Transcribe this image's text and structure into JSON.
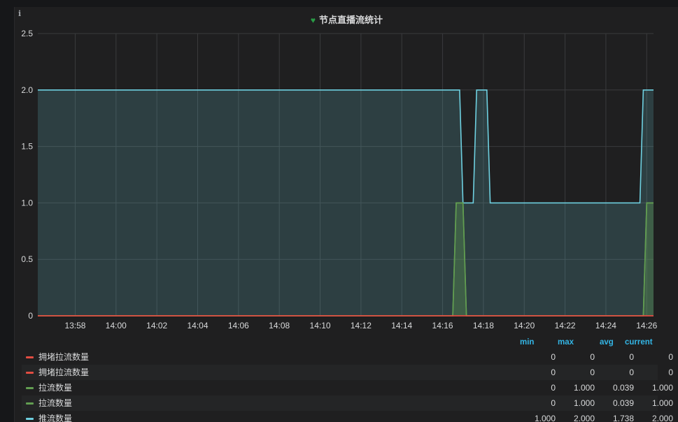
{
  "panel": {
    "title": "节点直播流统计",
    "info_glyph": "i",
    "title_icon": "heart-icon"
  },
  "chart_data": {
    "type": "line",
    "title": "节点直播流统计",
    "ylim": [
      0,
      2.5
    ],
    "yticks": [
      "0",
      "0.5",
      "1.0",
      "1.5",
      "2.0",
      "2.5"
    ],
    "ytick_values": [
      0,
      0.5,
      1.0,
      1.5,
      2.0,
      2.5
    ],
    "xlim": [
      "13:56:10",
      "14:26:20"
    ],
    "xticks": [
      "13:58",
      "14:00",
      "14:02",
      "14:04",
      "14:06",
      "14:08",
      "14:10",
      "14:12",
      "14:14",
      "14:16",
      "14:18",
      "14:20",
      "14:22",
      "14:24",
      "14:26"
    ],
    "grid": true,
    "legend_placement": "bottom",
    "series": [
      {
        "name": "拥堵拉流数量",
        "color": "#e24d42",
        "x": [
          "13:56:10",
          "14:26:20"
        ],
        "y": [
          0,
          0
        ]
      },
      {
        "name": "拥堵拉流数量",
        "color": "#e24d42",
        "x": [
          "13:56:10",
          "14:26:20"
        ],
        "y": [
          0,
          0
        ]
      },
      {
        "name": "拉流数量",
        "color": "#629e51",
        "x": [
          "13:56:10",
          "14:16:30",
          "14:16:40",
          "14:17:00",
          "14:17:10",
          "14:25:50",
          "14:26:00",
          "14:26:20"
        ],
        "y": [
          0,
          0,
          1,
          1,
          0,
          0,
          1,
          1
        ]
      },
      {
        "name": "拉流数量",
        "color": "#629e51",
        "x": [
          "13:56:10",
          "14:16:30",
          "14:16:40",
          "14:17:00",
          "14:17:10",
          "14:25:50",
          "14:26:00",
          "14:26:20"
        ],
        "y": [
          0,
          0,
          1,
          1,
          0,
          0,
          1,
          1
        ]
      },
      {
        "name": "推流数量",
        "color": "#6ed0e0",
        "x": [
          "13:56:10",
          "14:16:50",
          "14:17:00",
          "14:17:30",
          "14:17:40",
          "14:18:10",
          "14:18:20",
          "14:25:40",
          "14:25:50",
          "14:26:20"
        ],
        "y": [
          2,
          2,
          1,
          1,
          2,
          2,
          1,
          1,
          2,
          2
        ]
      }
    ]
  },
  "legend": {
    "headers": {
      "min": "min",
      "max": "max",
      "avg": "avg",
      "current": "current"
    },
    "rows": [
      {
        "name": "拥堵拉流数量",
        "color": "#e24d42",
        "min": "0",
        "max": "0",
        "avg": "0",
        "current": "0"
      },
      {
        "name": "拥堵拉流数量",
        "color": "#e24d42",
        "min": "0",
        "max": "0",
        "avg": "0",
        "current": "0"
      },
      {
        "name": "拉流数量",
        "color": "#629e51",
        "min": "0",
        "max": "1.000",
        "avg": "0.039",
        "current": "1.000"
      },
      {
        "name": "拉流数量",
        "color": "#629e51",
        "min": "0",
        "max": "1.000",
        "avg": "0.039",
        "current": "1.000"
      },
      {
        "name": "推流数量",
        "color": "#6ed0e0",
        "min": "1.000",
        "max": "2.000",
        "avg": "1.738",
        "current": "2.000"
      }
    ]
  }
}
